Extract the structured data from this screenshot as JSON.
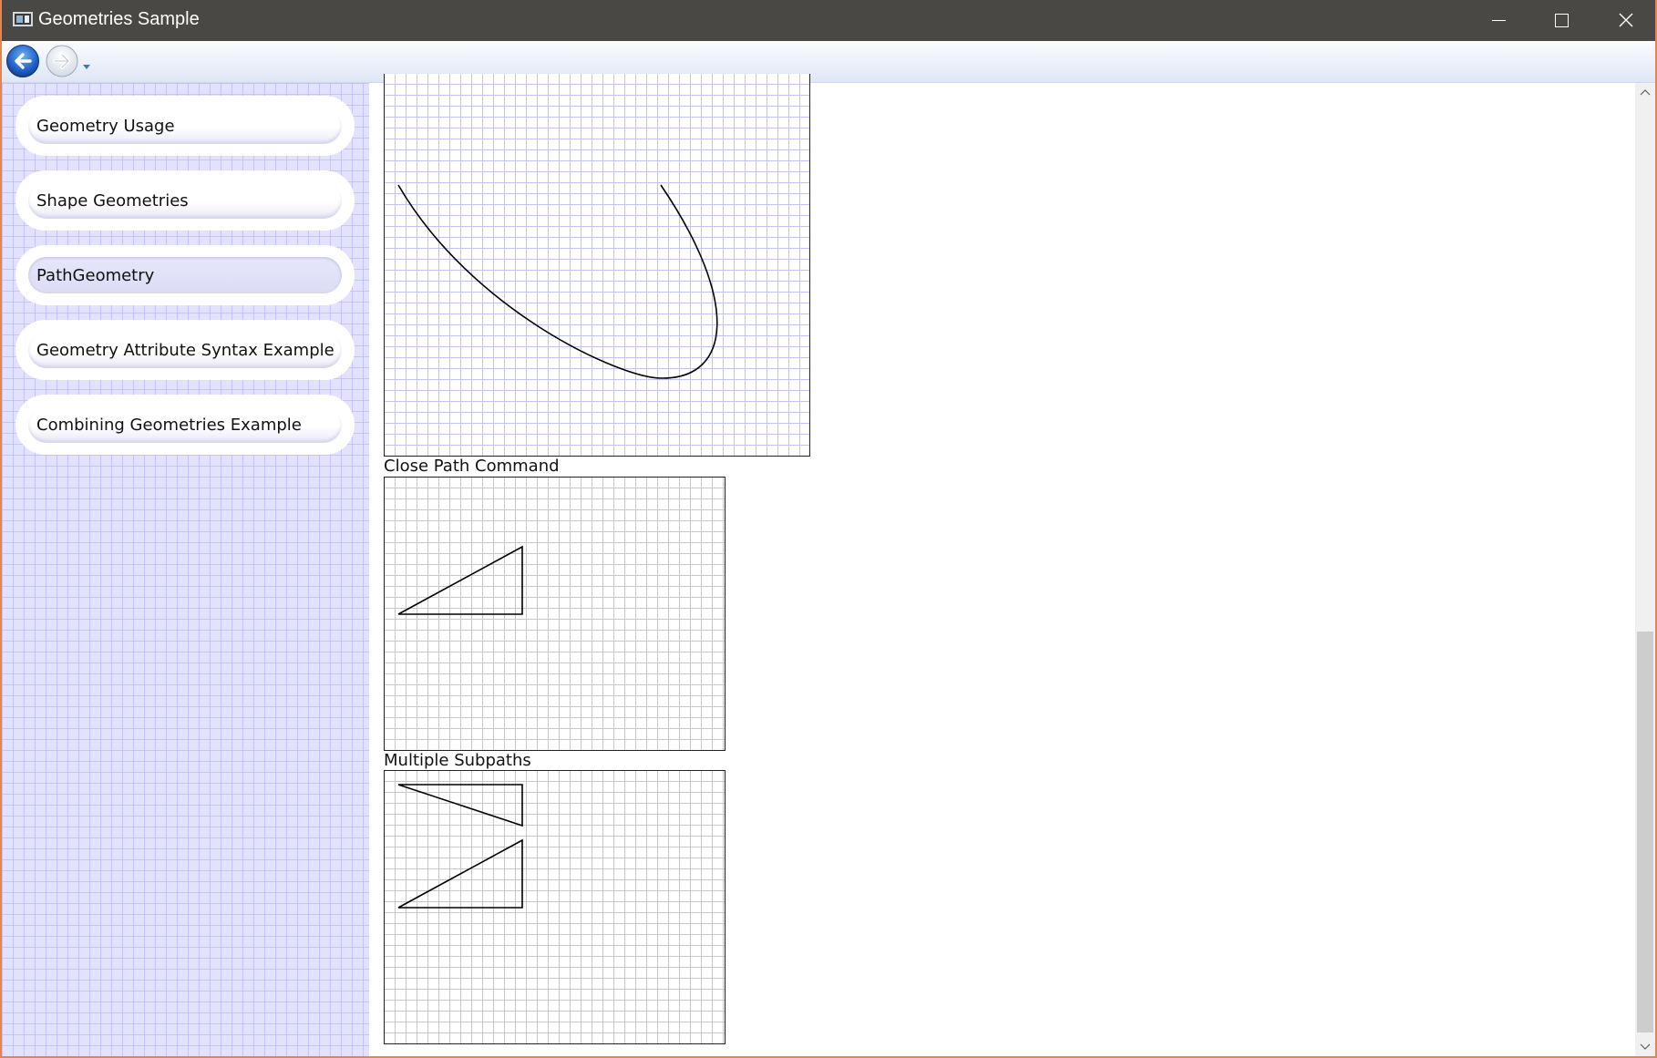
{
  "window": {
    "title": "Geometries Sample",
    "controls": {
      "minimize": "minimize-icon",
      "maximize": "maximize-icon",
      "close": "close-icon"
    }
  },
  "navbar": {
    "back": "back-arrow-icon",
    "forward": "forward-arrow-icon",
    "history": "chevron-down-icon"
  },
  "sidebar": {
    "items": [
      {
        "label": "Geometry Usage",
        "selected": false
      },
      {
        "label": "Shape Geometries",
        "selected": false
      },
      {
        "label": "PathGeometry",
        "selected": true
      },
      {
        "label": "Geometry Attribute Syntax Example",
        "selected": false
      },
      {
        "label": "Combining Geometries Example",
        "selected": false
      }
    ]
  },
  "content": {
    "sections": [
      {
        "label": ""
      },
      {
        "label": "Close Path Command"
      },
      {
        "label": "Multiple Subpaths"
      }
    ]
  },
  "colors": {
    "titlebar": "#4a4845",
    "sidebar_bg": "#e2e2ff",
    "grid_line": "#c3c3f0",
    "window_border": "#e0864e"
  }
}
